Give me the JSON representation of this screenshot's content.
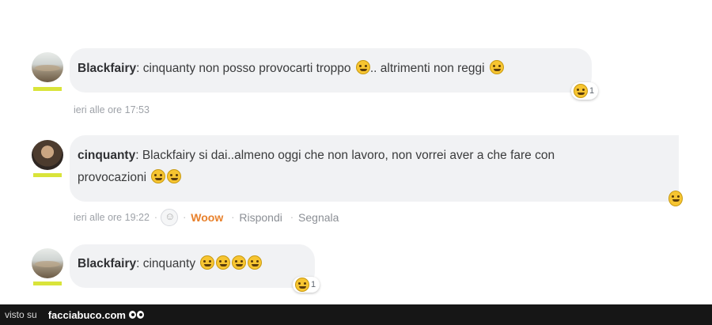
{
  "comments": [
    {
      "author": "Blackfairy",
      "text_part1": ": cinquanty non posso provocarti troppo",
      "text_part2": ".. altrimenti non reggi",
      "reaction_count": "1",
      "timestamp": "ieri alle ore 17:53"
    },
    {
      "author": "cinquanty",
      "text_line1": ": Blackfairy si dai..almeno oggi che non lavoro, non vorrei aver a che fare con",
      "text_line2": "provocazioni",
      "timestamp": "ieri alle ore 19:22",
      "sep": "·",
      "woow_label": "Woow",
      "reply_label": "Rispondi",
      "report_label": "Segnala"
    },
    {
      "author": "Blackfairy",
      "text": ": cinquanty",
      "reaction_count": "1"
    }
  ],
  "footer": {
    "visto_label": "visto su",
    "brand": "facciabuco.com"
  },
  "colors": {
    "bubble": "#f1f2f4",
    "woow": "#e8812c",
    "footer": "#161616",
    "flag": "#d9e43a"
  }
}
